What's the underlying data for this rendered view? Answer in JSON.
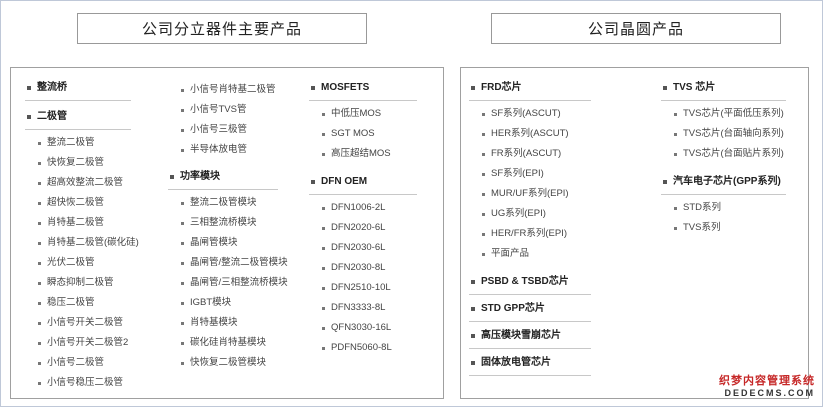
{
  "headers": {
    "left": "公司分立器件主要产品",
    "right": "公司晶圆产品"
  },
  "left_panel": {
    "col1": {
      "heading1": "整流桥",
      "heading2": "二极管",
      "items": [
        "整流二极管",
        "快恢复二极管",
        "超高效整流二极管",
        "超快恢二极管",
        "肖特基二极管",
        "肖特基二极管(碳化硅)",
        "光伏二极管",
        "瞬态抑制二极管",
        "稳压二极管",
        "小信号开关二极管",
        "小信号开关二极管2",
        "小信号二极管",
        "小信号稳压二极管"
      ]
    },
    "col2": {
      "top_items": [
        "小信号肖特基二极管",
        "小信号TVS管",
        "小信号三极管",
        "半导体放电管"
      ],
      "heading": "功率模块",
      "items": [
        "整流二极管模块",
        "三相整流桥模块",
        "晶闸管模块",
        "晶闸管/整流二极管模块",
        "晶闸管/三相整流桥模块",
        "IGBT模块",
        "肖特基模块",
        "碳化硅肖特基模块",
        "快恢复二极管模块"
      ]
    },
    "col3": {
      "heading1": "MOSFETS",
      "items1": [
        "中低压MOS",
        "SGT MOS",
        "高压超结MOS"
      ],
      "heading2": "DFN OEM",
      "items2": [
        "DFN1006-2L",
        "DFN2020-6L",
        "DFN2030-6L",
        "DFN2030-8L",
        "DFN2510-10L",
        "DFN3333-8L",
        "QFN3030-16L",
        "PDFN5060-8L"
      ]
    }
  },
  "right_panel": {
    "col1": {
      "heading1": "FRD芯片",
      "items1": [
        "SF系列(ASCUT)",
        "HER系列(ASCUT)",
        "FR系列(ASCUT)",
        "SF系列(EPI)",
        "MUR/UF系列(EPI)",
        "UG系列(EPI)",
        "HER/FR系列(EPI)",
        "平面产品"
      ],
      "heading2": "PSBD & TSBD芯片",
      "heading3": "STD GPP芯片",
      "heading4": "高压模块雪崩芯片",
      "heading5": "固体放电管芯片"
    },
    "col2": {
      "heading1": "TVS 芯片",
      "items1": [
        "TVS芯片(平面低压系列)",
        "TVS芯片(台面轴向系列)",
        "TVS芯片(台面贴片系列)"
      ],
      "heading2": "汽车电子芯片(GPP系列)",
      "items2": [
        "STD系列",
        "TVS系列"
      ]
    }
  },
  "watermark": {
    "line1": "织梦内容管理系统",
    "line2": "DEDECMS.COM"
  }
}
